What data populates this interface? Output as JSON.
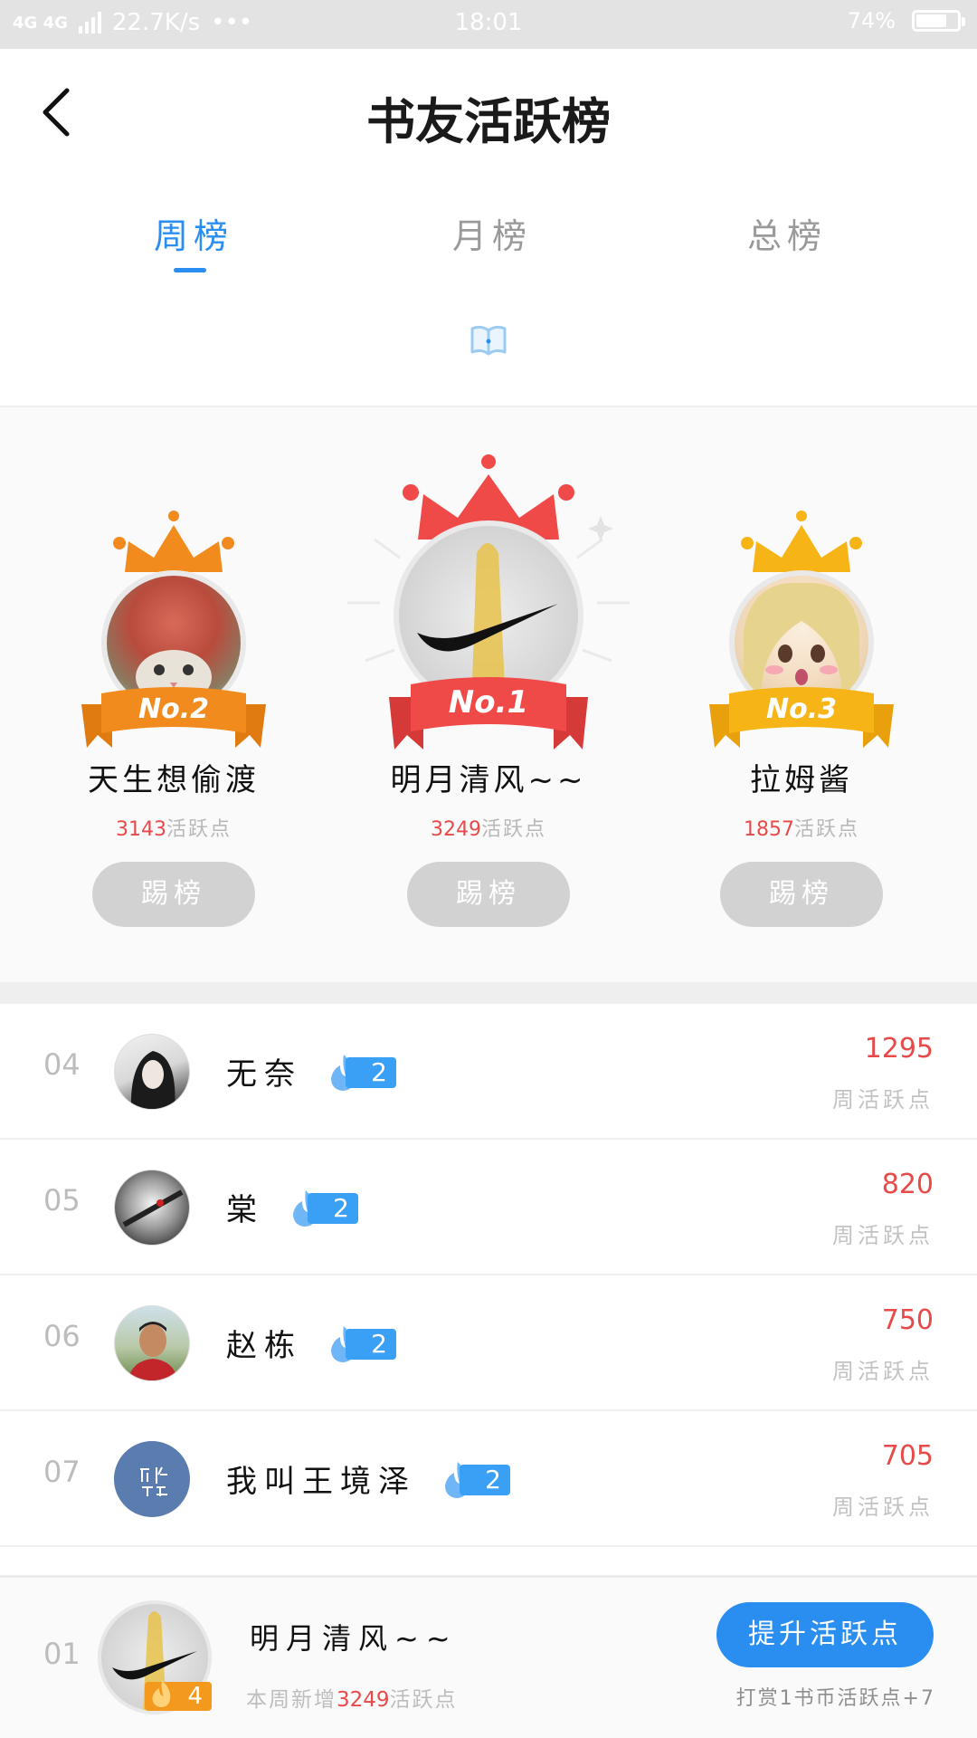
{
  "status_bar": {
    "network": "4G 4G",
    "speed": "22.7K/s",
    "dots": "•••",
    "time": "18:01",
    "battery": "74%",
    "battery_level": 0.74
  },
  "header": {
    "back_icon": "chevron-left-icon",
    "title": "书友活跃榜"
  },
  "tabs": [
    {
      "label": "周榜",
      "active": true
    },
    {
      "label": "月榜",
      "active": false
    },
    {
      "label": "总榜",
      "active": false
    }
  ],
  "book_icon": "book-open-icon",
  "podium": {
    "kick_label": "踢榜",
    "points_suffix": "活跃点",
    "first": {
      "badge": "No.1",
      "name": "明月清风~~",
      "points": "3249",
      "crown_color": "#ef4a48"
    },
    "second": {
      "badge": "No.2",
      "name": "天生想偷渡",
      "points": "3143",
      "crown_color": "#f28b1d"
    },
    "third": {
      "badge": "No.3",
      "name": "拉姆酱",
      "points": "1857",
      "crown_color": "#f6b417"
    }
  },
  "list": {
    "score_label": "周活跃点",
    "rows": [
      {
        "rank": "04",
        "name": "无奈",
        "level": "2",
        "score": "1295"
      },
      {
        "rank": "05",
        "name": "棠",
        "level": "2",
        "score": "820"
      },
      {
        "rank": "06",
        "name": "赵栋",
        "level": "2",
        "score": "750"
      },
      {
        "rank": "07",
        "name": "我叫王境泽",
        "level": "2",
        "score": "705"
      }
    ]
  },
  "my_rank": {
    "rank": "01",
    "name": "明月清风~~",
    "level": "4",
    "sub_prefix": "本周新增",
    "sub_points": "3249",
    "sub_suffix": "活跃点",
    "boost_label": "提升活跃点",
    "reward_text": "打赏1书币活跃点+7"
  },
  "colors": {
    "accent": "#2a8df0",
    "score_red": "#e84a4a",
    "kick_gray": "#d2d2d2"
  }
}
